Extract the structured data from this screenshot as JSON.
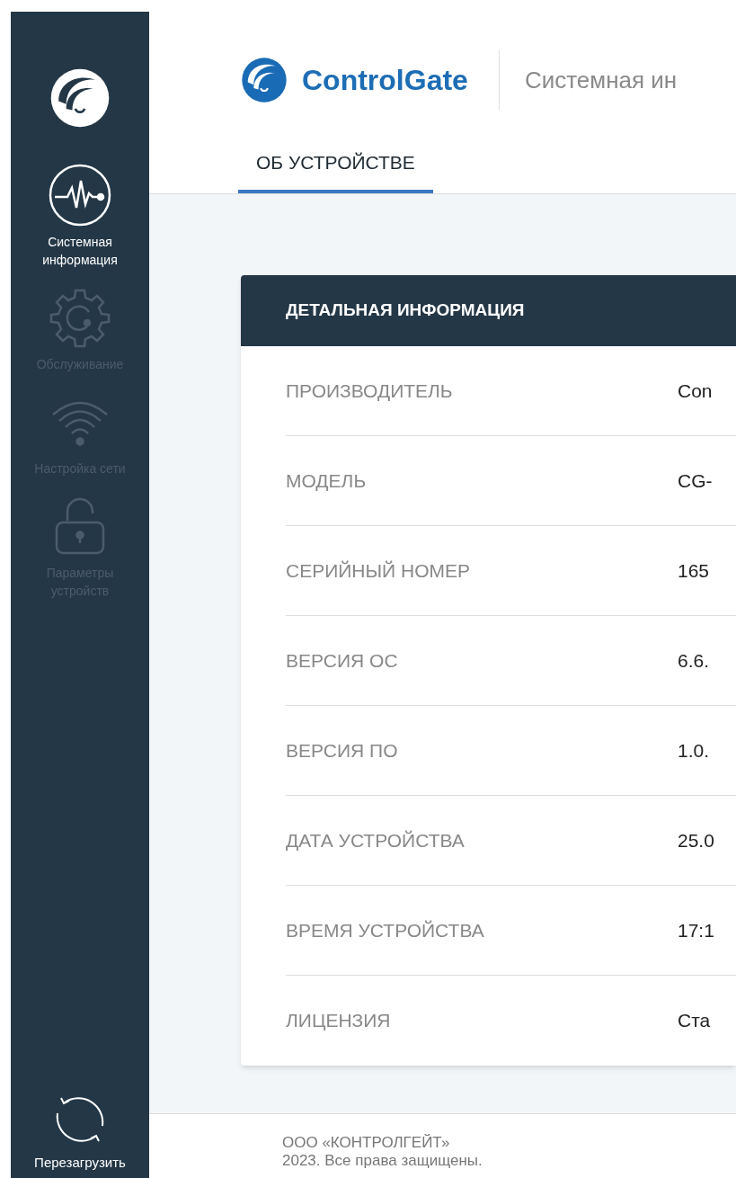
{
  "sidebar": {
    "items": [
      {
        "label": "Системная информация",
        "kind": "pulse",
        "selected": true
      },
      {
        "label": "Обслуживание",
        "kind": "gear",
        "selected": false
      },
      {
        "label": "Настройка сети",
        "kind": "wifi",
        "selected": false
      },
      {
        "label": "Параметры устройств",
        "kind": "lock",
        "selected": false
      }
    ],
    "reboot": {
      "label": "Перезагрузить"
    }
  },
  "header": {
    "brand": "ControlGate",
    "subtitle": "Системная ин"
  },
  "tabs": [
    {
      "label": "ОБ УСТРОЙСТВЕ",
      "selected": true
    }
  ],
  "card": {
    "title": "ДЕТАЛЬНАЯ ИНФОРМАЦИЯ",
    "rows": [
      {
        "label": "ПРОИЗВОДИТЕЛЬ",
        "value": "Con"
      },
      {
        "label": "МОДЕЛЬ",
        "value": "CG-"
      },
      {
        "label": "СЕРИЙНЫЙ НОМЕР",
        "value": "165"
      },
      {
        "label": "ВЕРСИЯ ОС",
        "value": "6.6."
      },
      {
        "label": "ВЕРСИЯ ПО",
        "value": "1.0."
      },
      {
        "label": "ДАТА УСТРОЙСТВА",
        "value": "25.0"
      },
      {
        "label": "ВРЕМЯ УСТРОЙСТВА",
        "value": "17:1"
      },
      {
        "label": "ЛИЦЕНЗИЯ",
        "value": "Ста"
      }
    ]
  },
  "footer": {
    "lines": [
      "ООО «КОНТРОЛГЕЙТ»",
      "2023. Все права защищены."
    ]
  }
}
